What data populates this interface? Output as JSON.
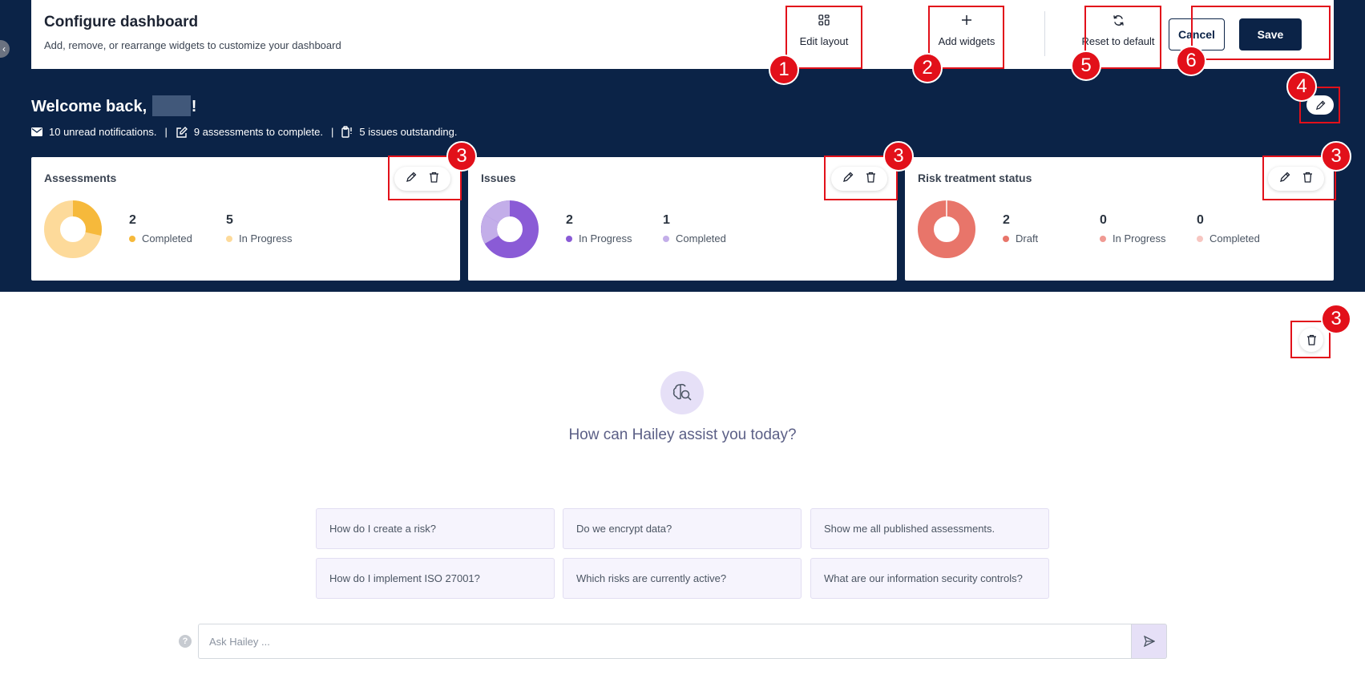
{
  "config": {
    "title": "Configure dashboard",
    "subtitle": "Add, remove, or rearrange widgets to customize your dashboard",
    "edit_layout": "Edit layout",
    "add_widgets": "Add widgets",
    "reset": "Reset to default",
    "cancel": "Cancel",
    "save": "Save"
  },
  "welcome": {
    "greeting_prefix": "Welcome back,",
    "greeting_suffix": "!",
    "notifications": "10 unread notifications.",
    "assessments": "9 assessments to complete.",
    "issues": "5 issues outstanding.",
    "separator": "|"
  },
  "widgets": [
    {
      "title": "Assessments",
      "legend": [
        {
          "value": "2",
          "label": "Completed",
          "color": "#f6b93b"
        },
        {
          "value": "5",
          "label": "In Progress",
          "color": "#fdda9a"
        }
      ]
    },
    {
      "title": "Issues",
      "legend": [
        {
          "value": "2",
          "label": "In Progress",
          "color": "#8a5bd6"
        },
        {
          "value": "1",
          "label": "Completed",
          "color": "#c3aee9"
        }
      ]
    },
    {
      "title": "Risk treatment status",
      "legend": [
        {
          "value": "2",
          "label": "Draft",
          "color": "#e8756a"
        },
        {
          "value": "0",
          "label": "In Progress",
          "color": "#f09a93"
        },
        {
          "value": "0",
          "label": "Completed",
          "color": "#f7c6c1"
        }
      ]
    }
  ],
  "assistant": {
    "heading": "How can Hailey assist you today?",
    "suggestions": [
      "How do I create a risk?",
      "Do we encrypt data?",
      "Show me all published assessments.",
      "How do I implement ISO 27001?",
      "Which risks are currently active?",
      "What are our information security controls?"
    ],
    "input_placeholder": "Ask Hailey ...",
    "help": "?"
  },
  "annotations": [
    "1",
    "2",
    "3",
    "4",
    "5",
    "6"
  ],
  "colors": {
    "navy": "#0b2347",
    "annotation_red": "#e2101a",
    "assistant_purple": "#e6e0f7"
  },
  "icons": {
    "edit_layout": "layout-grid-icon",
    "add_widgets": "plus-icon",
    "reset": "refresh-icon",
    "edit": "pencil-icon",
    "delete": "trash-icon",
    "mail": "envelope-icon",
    "assessment": "edit-square-icon",
    "issue": "clipboard-alert-icon",
    "hailey": "brain-search-icon",
    "send": "send-icon",
    "help": "question-icon"
  }
}
